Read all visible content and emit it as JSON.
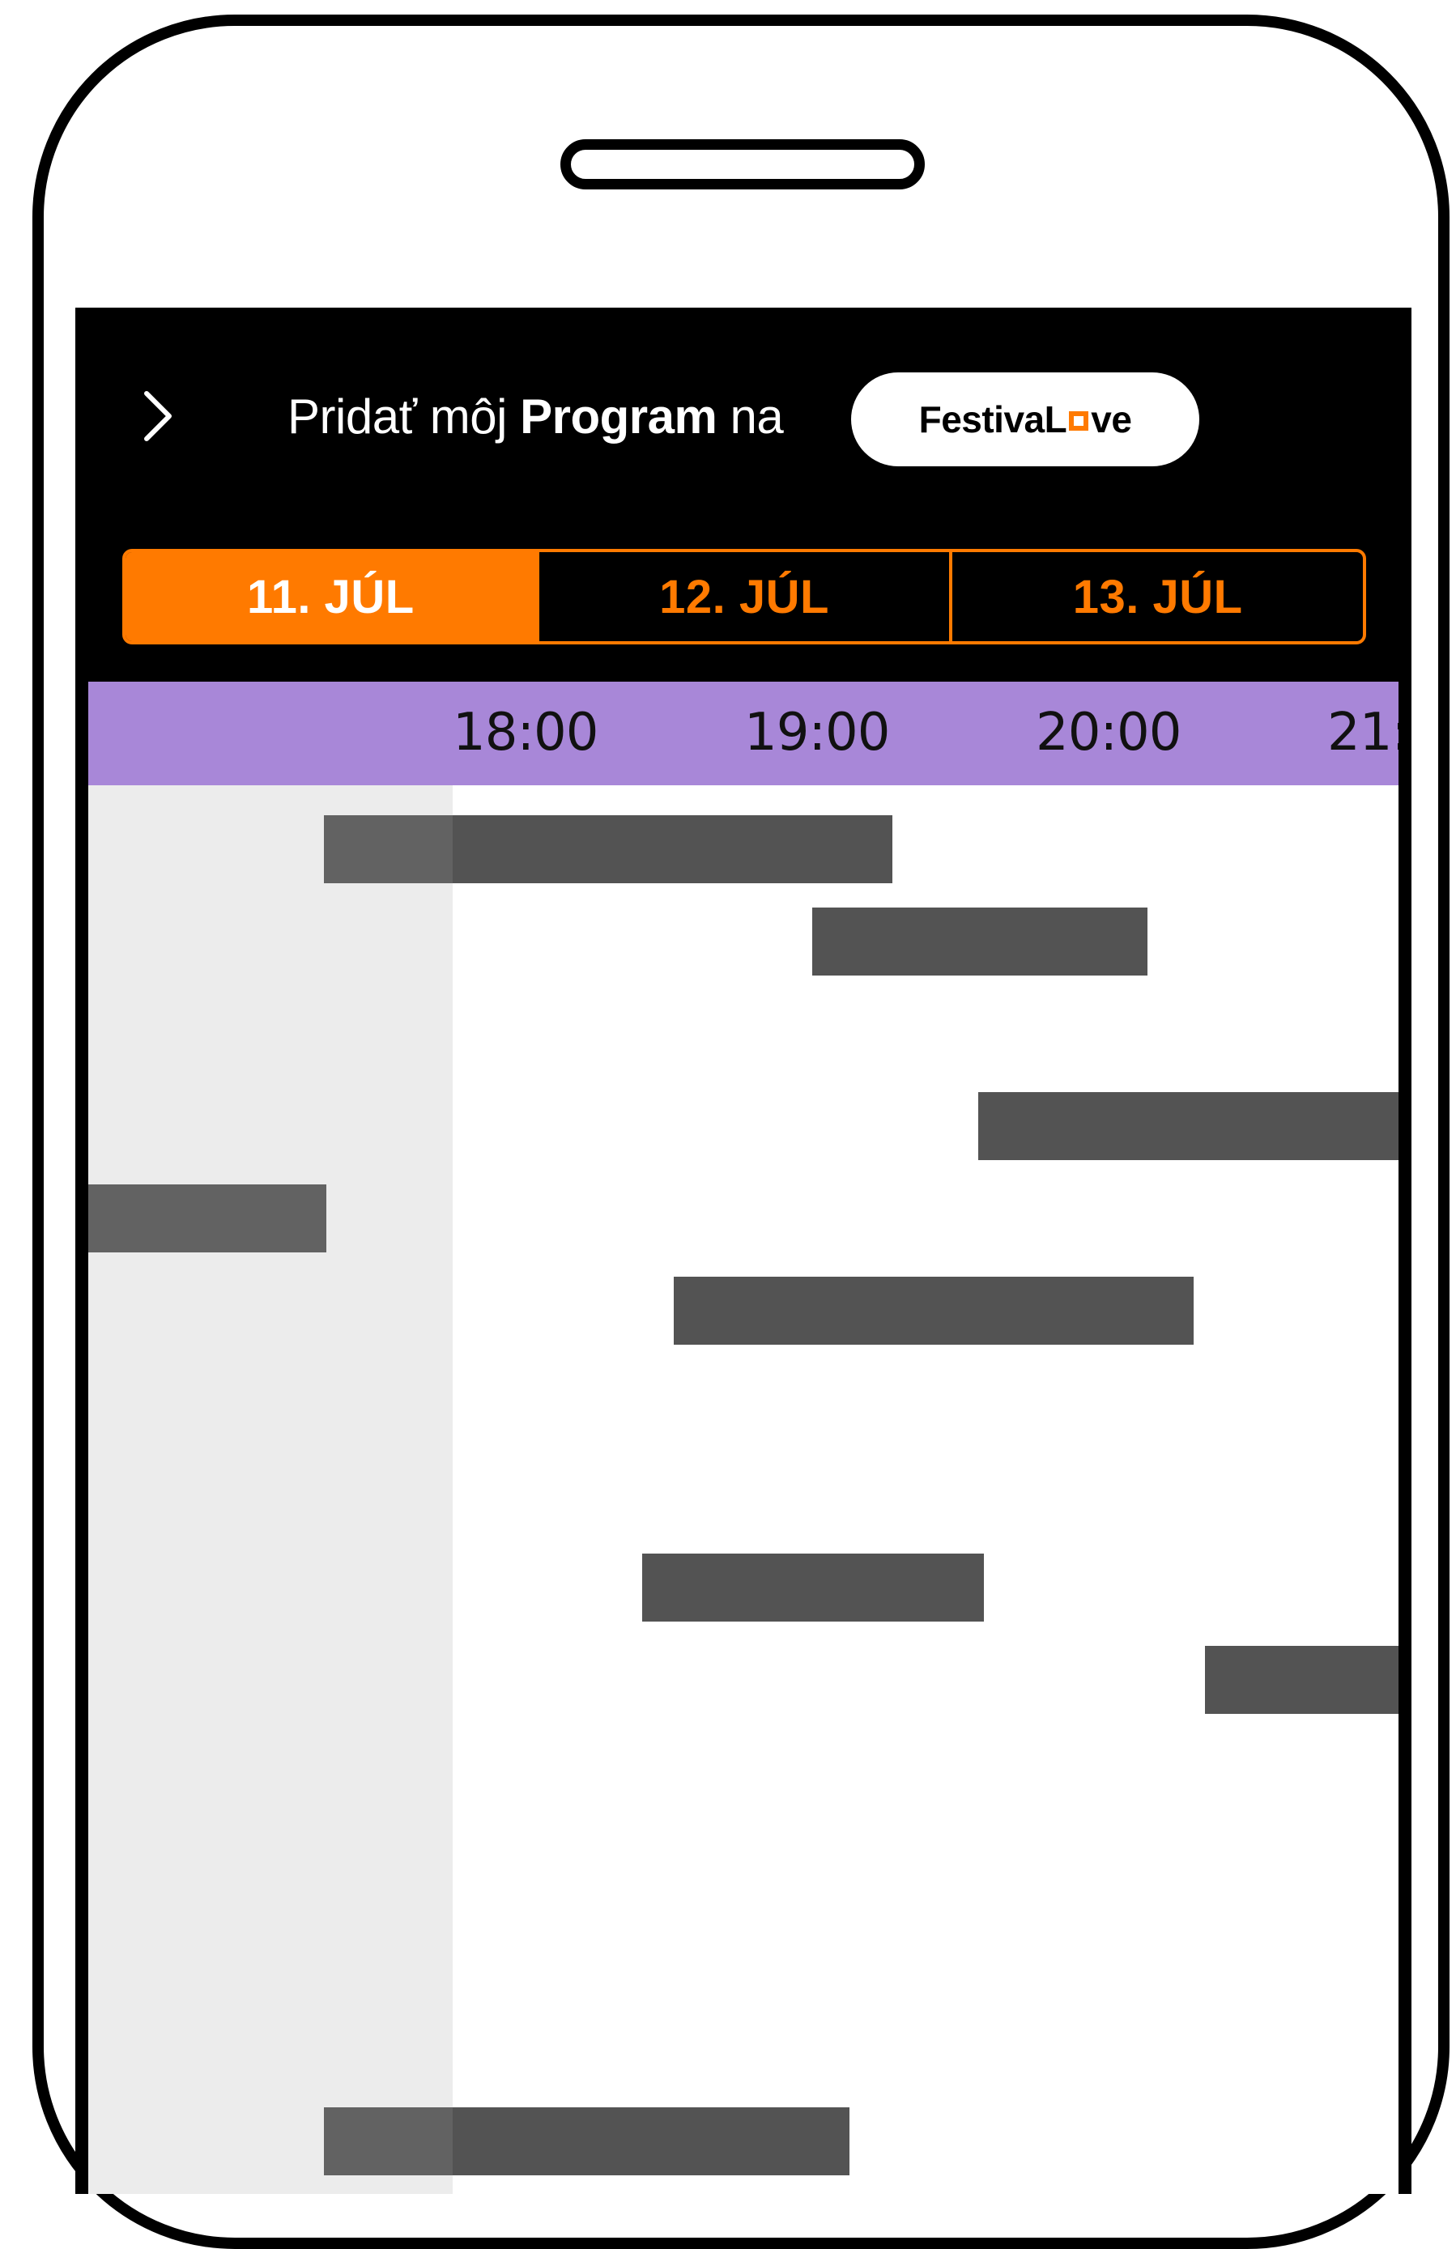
{
  "header": {
    "text_pre": "Pridať môj ",
    "text_bold": "Program",
    "text_post": " na",
    "brand_part1": "FestivaL",
    "brand_part2": "ve"
  },
  "date_tabs": [
    {
      "label": "11. JÚL",
      "active": true
    },
    {
      "label": "12. JÚL",
      "active": false
    },
    {
      "label": "13. JÚL",
      "active": false
    }
  ],
  "timeline": {
    "time_labels": [
      "18:00",
      "19:00",
      "20:00",
      "21:"
    ],
    "events": [
      {
        "row": 0,
        "start": 16.57,
        "end": 18.55
      },
      {
        "row": 1,
        "start": 18.27,
        "end": 19.44
      },
      {
        "row": 3,
        "start": 18.85,
        "end": 20.67
      },
      {
        "row": 4,
        "start": 15.75,
        "end": 16.58
      },
      {
        "row": 5,
        "start": 17.79,
        "end": 19.6
      },
      {
        "row": 5,
        "start": 20.39,
        "end": 21.2
      },
      {
        "row": 8,
        "start": 17.68,
        "end": 18.87
      },
      {
        "row": 9,
        "start": 19.64,
        "end": 20.48
      },
      {
        "row": 14,
        "start": 16.57,
        "end": 18.4
      }
    ]
  },
  "colors": {
    "accent": "#ff7a00",
    "timeline_header": "#a887d8",
    "event_block": "#535353",
    "past_area": "#ececec"
  }
}
